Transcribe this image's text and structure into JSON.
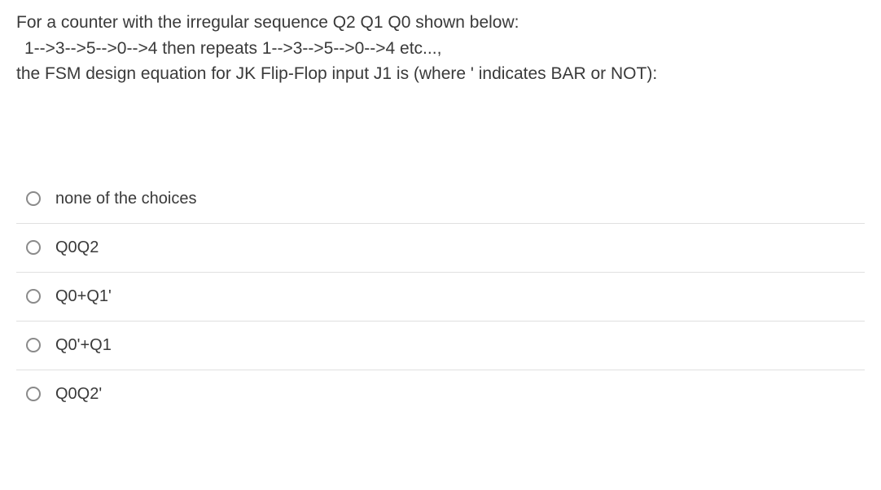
{
  "question": {
    "line1": "For a counter with the irregular sequence Q2 Q1 Q0 shown below:",
    "line2": "1-->3-->5-->0-->4 then repeats 1-->3-->5-->0-->4 etc...,",
    "line3": "the FSM design equation for JK Flip-Flop input J1 is (where ' indicates BAR or NOT):"
  },
  "choices": [
    {
      "label": "none of the choices"
    },
    {
      "label": "Q0Q2"
    },
    {
      "label": "Q0+Q1'"
    },
    {
      "label": "Q0'+Q1"
    },
    {
      "label": "Q0Q2'"
    }
  ]
}
